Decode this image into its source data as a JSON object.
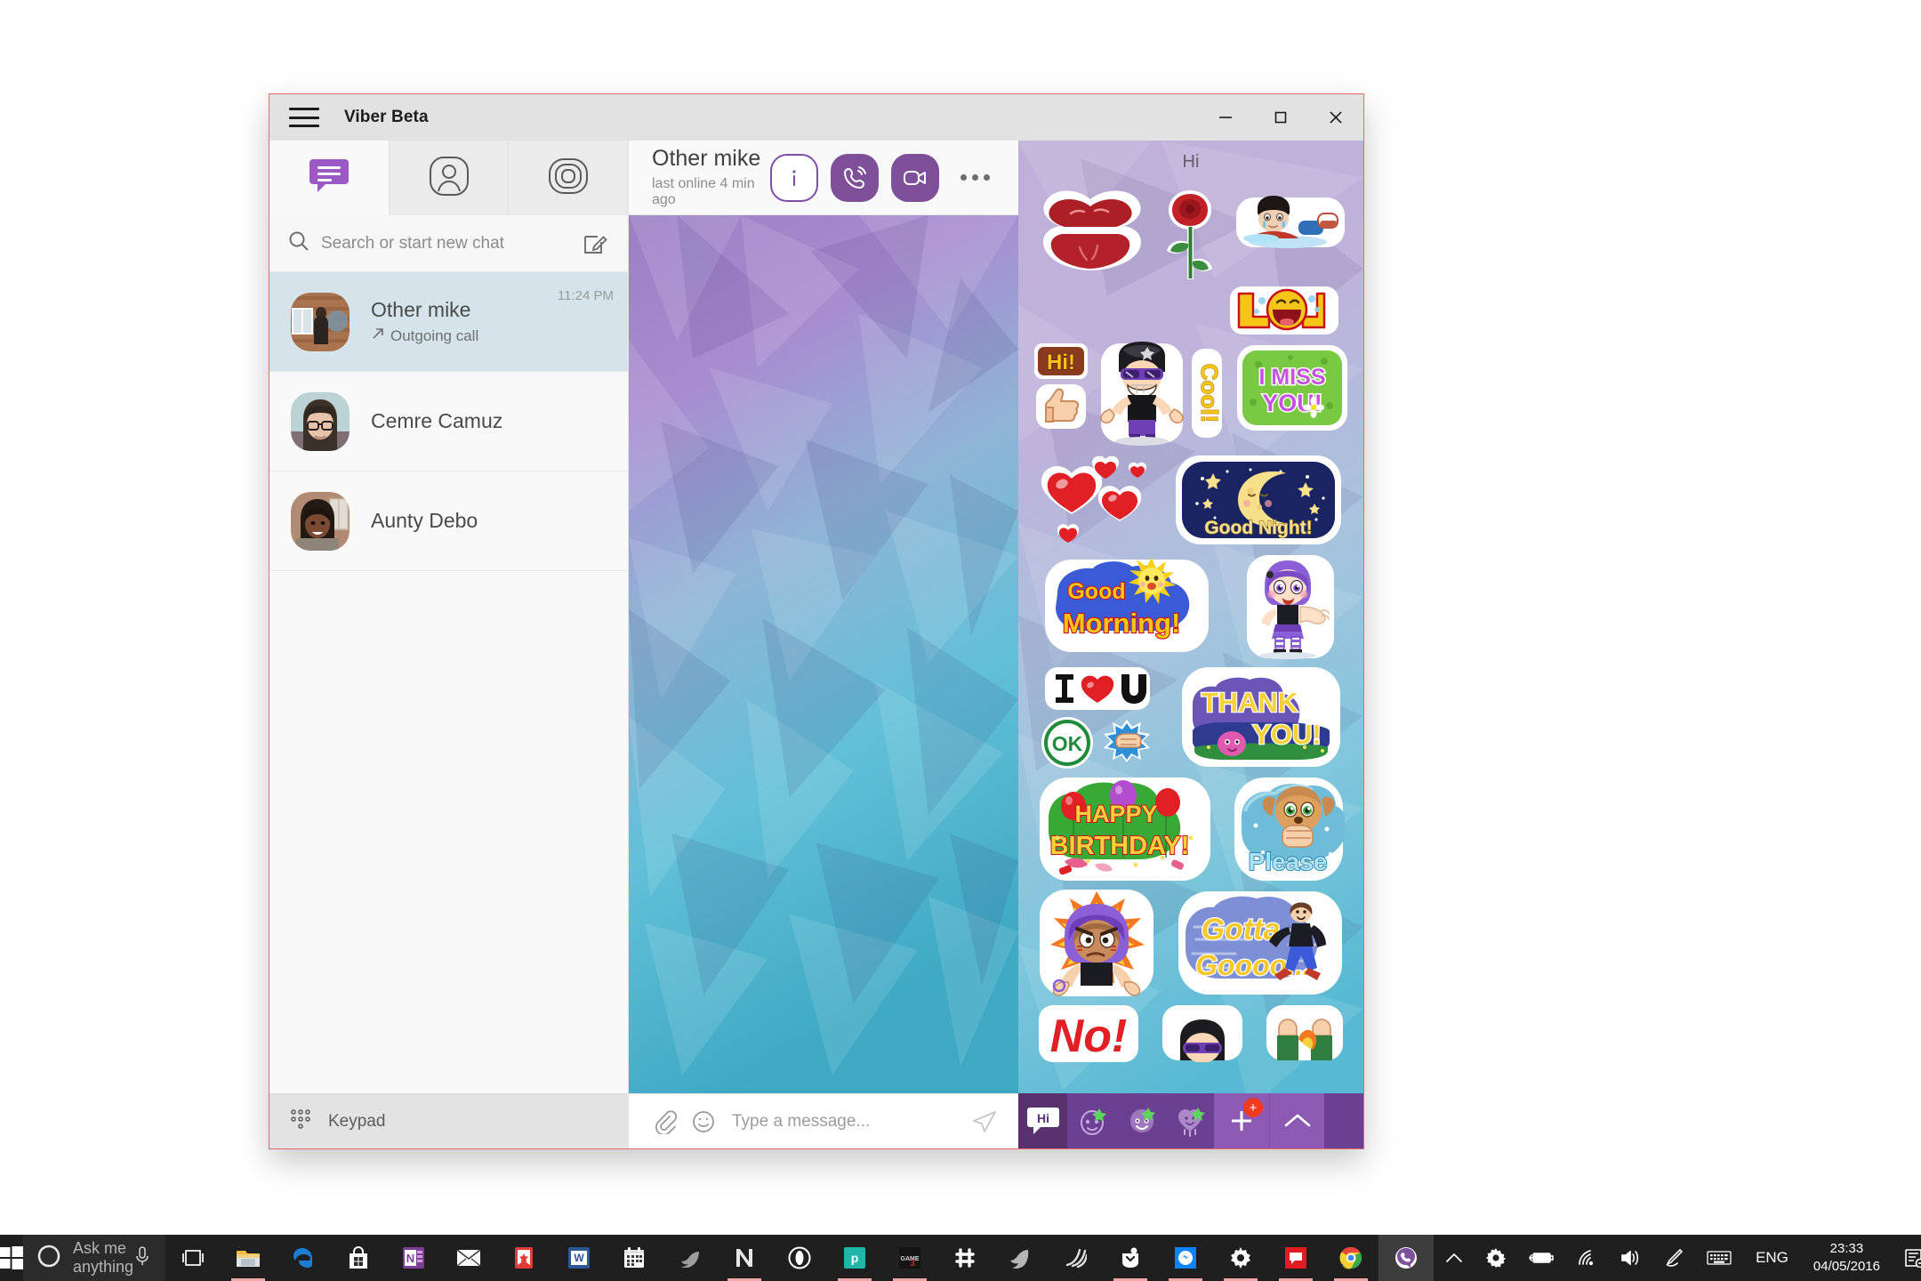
{
  "window": {
    "title": "Viber Beta",
    "menu_icon": "hamburger-icon",
    "minimize_label": "Minimize",
    "maximize_label": "Maximize",
    "close_label": "Close"
  },
  "nav_tabs": [
    {
      "name": "chats",
      "icon": "chat-bubble-icon",
      "active": true
    },
    {
      "name": "contacts",
      "icon": "person-icon",
      "active": false
    },
    {
      "name": "calls",
      "icon": "calls-icon",
      "active": false
    }
  ],
  "search": {
    "placeholder": "Search or start new chat",
    "value": "",
    "icon": "search-icon",
    "compose_icon": "compose-icon"
  },
  "chats": [
    {
      "name": "Other mike",
      "subtitle": "Outgoing call",
      "time": "11:24 PM",
      "selected": true,
      "has_call_arrow": true
    },
    {
      "name": "Cemre Camuz",
      "subtitle": "",
      "time": "",
      "selected": false,
      "has_call_arrow": false
    },
    {
      "name": "Aunty Debo",
      "subtitle": "",
      "time": "",
      "selected": false,
      "has_call_arrow": false
    }
  ],
  "keypad": {
    "label": "Keypad",
    "icon": "keypad-icon"
  },
  "conversation": {
    "name": "Other mike",
    "status": "last online 4 min ago",
    "info_label": "i",
    "call_icon": "phone-icon",
    "video_icon": "video-camera-icon",
    "more_icon": "more-options-icon"
  },
  "message_bar": {
    "placeholder": "Type a message...",
    "value": "",
    "attach_icon": "paperclip-icon",
    "emoji_icon": "smiley-icon",
    "send_icon": "send-icon"
  },
  "sticker_panel": {
    "header": "Hi",
    "rows": [
      [
        {
          "name": "kiss-lips-sticker",
          "label": ""
        },
        {
          "name": "red-rose-sticker",
          "label": ""
        },
        {
          "name": "sad-boy-sticker",
          "label": ""
        }
      ],
      [
        {
          "name": "lol-sticker",
          "label": "LOL"
        }
      ],
      [
        {
          "name": "hi-sticker",
          "label": "Hi!"
        },
        {
          "name": "cool-guy-sticker",
          "label": "Cool!"
        },
        {
          "name": "i-miss-you-sticker",
          "label": "I MISS YOU!"
        }
      ],
      [
        {
          "name": "thumbs-up-sticker",
          "label": ""
        },
        {
          "name": "hearts-sticker",
          "label": ""
        },
        {
          "name": "good-night-sticker",
          "label": "Good Night!"
        }
      ],
      [
        {
          "name": "good-morning-sticker",
          "label": "Good Morning!"
        },
        {
          "name": "waving-girl-sticker",
          "label": ""
        }
      ],
      [
        {
          "name": "i-love-u-sticker",
          "label": "I ♥ U"
        },
        {
          "name": "thank-you-sticker",
          "label": "THANK YOU!"
        }
      ],
      [
        {
          "name": "ok-sticker",
          "label": "OK"
        },
        {
          "name": "fist-bump-sticker",
          "label": ""
        }
      ],
      [
        {
          "name": "happy-birthday-sticker",
          "label": "HAPPY BIRTHDAY!"
        },
        {
          "name": "please-puppy-sticker",
          "label": "Please"
        }
      ],
      [
        {
          "name": "angry-girl-sticker",
          "label": ""
        },
        {
          "name": "gotta-go-sticker",
          "label": "Gotta Gooooo..."
        }
      ],
      [
        {
          "name": "no-sticker",
          "label": "No!"
        },
        {
          "name": "cool-guy-small-sticker",
          "label": ""
        },
        {
          "name": "cheering-sticker",
          "label": ""
        }
      ]
    ],
    "tabs": [
      {
        "name": "recent-hi-tab",
        "label": "Hi",
        "type": "bubble",
        "active": true
      },
      {
        "name": "sticker-pack-1-tab",
        "label": "",
        "type": "face",
        "active": false
      },
      {
        "name": "sticker-pack-2-tab",
        "label": "",
        "type": "face2",
        "active": false
      },
      {
        "name": "sticker-pack-3-tab",
        "label": "",
        "type": "heart",
        "active": false
      }
    ],
    "add_button": {
      "name": "add-sticker-pack-button",
      "label": "+",
      "badge": "+"
    },
    "collapse_button": {
      "name": "collapse-stickers-button",
      "label": "^"
    }
  },
  "taskbar": {
    "start": {
      "name": "start-button",
      "icon": "windows-logo-icon"
    },
    "cortana": {
      "placeholder": "Ask me anything",
      "mic_icon": "microphone-icon"
    },
    "apps": [
      {
        "name": "task-view-button",
        "icon": "task-view-icon",
        "running": false,
        "active": false
      },
      {
        "name": "file-explorer-button",
        "icon": "folder-icon",
        "running": true,
        "active": false
      },
      {
        "name": "microsoft-edge-button",
        "icon": "edge-icon",
        "running": false,
        "active": false
      },
      {
        "name": "microsoft-store-button",
        "icon": "store-bag-icon",
        "running": false,
        "active": false
      },
      {
        "name": "onenote-button",
        "icon": "onenote-icon",
        "running": false,
        "active": false
      },
      {
        "name": "mail-button",
        "icon": "envelope-icon",
        "running": false,
        "active": false
      },
      {
        "name": "wunderlist-button",
        "icon": "wunderlist-icon",
        "running": false,
        "active": false
      },
      {
        "name": "word-button",
        "icon": "word-icon",
        "running": false,
        "active": false
      },
      {
        "name": "calendar-button",
        "icon": "calendar-icon",
        "running": false,
        "active": false
      },
      {
        "name": "bird-app-button",
        "icon": "bird-icon",
        "running": false,
        "active": false
      },
      {
        "name": "n-app-button",
        "icon": "letter-n-icon",
        "running": true,
        "active": false
      },
      {
        "name": "opera-button",
        "icon": "opera-icon",
        "running": false,
        "active": false
      },
      {
        "name": "paint-net-button",
        "icon": "paint-net-icon",
        "running": true,
        "active": false
      },
      {
        "name": "red-app-button",
        "icon": "red-square-icon",
        "running": false,
        "active": false
      },
      {
        "name": "slack-button",
        "icon": "hash-icon",
        "running": false,
        "active": false
      },
      {
        "name": "gray-app-button",
        "icon": "gray-swirl-icon",
        "running": false,
        "active": false
      },
      {
        "name": "lines-app-button",
        "icon": "lines-icon",
        "running": false,
        "active": false
      },
      {
        "name": "pocket-button",
        "icon": "pocket-icon",
        "running": true,
        "active": false
      },
      {
        "name": "messenger-button",
        "icon": "messenger-icon",
        "running": true,
        "active": false
      },
      {
        "name": "settings-button",
        "icon": "gear-icon",
        "running": true,
        "active": false
      },
      {
        "name": "youtube-button",
        "icon": "speech-bubble-icon",
        "running": true,
        "active": false
      },
      {
        "name": "chrome-button",
        "icon": "chrome-icon",
        "running": true,
        "active": false
      },
      {
        "name": "viber-button",
        "icon": "viber-icon",
        "running": true,
        "active": true
      }
    ],
    "tray": [
      {
        "name": "show-hidden-icons-button",
        "icon": "chevron-up-icon"
      },
      {
        "name": "settings-tray-icon",
        "icon": "gear-icon"
      },
      {
        "name": "battery-tray-icon",
        "icon": "battery-charging-icon"
      },
      {
        "name": "network-tray-icon",
        "icon": "wifi-icon"
      },
      {
        "name": "volume-tray-icon",
        "icon": "speaker-icon"
      },
      {
        "name": "pen-tray-icon",
        "icon": "pen-icon"
      },
      {
        "name": "touch-keyboard-button",
        "icon": "keyboard-icon"
      }
    ],
    "language": "ENG",
    "clock": {
      "time": "23:33",
      "date": "04/05/2016"
    },
    "action_center": {
      "name": "action-center-button",
      "icon": "notification-icon"
    }
  },
  "colors": {
    "viber_purple": "#7d5099",
    "sticker_bar": "#6b3f91",
    "selected_chat": "#d5e4ea",
    "badge_red": "#ef3c20",
    "window_border": "#e86b6b"
  }
}
